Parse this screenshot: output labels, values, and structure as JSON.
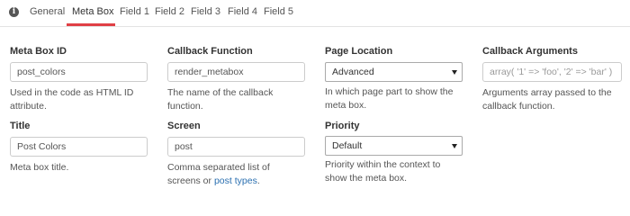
{
  "tabs": {
    "items": [
      {
        "label": "General"
      },
      {
        "label": "Meta Box"
      },
      {
        "label": "Field 1"
      },
      {
        "label": "Field 2"
      },
      {
        "label": "Field 3"
      },
      {
        "label": "Field 4"
      },
      {
        "label": "Field 5"
      }
    ],
    "active_index": 1,
    "info_icon": "info-icon"
  },
  "meta_box_id": {
    "label": "Meta Box ID",
    "value": "post_colors",
    "help": "Used in the code as HTML ID attribute."
  },
  "title": {
    "label": "Title",
    "value": "Post Colors",
    "help": "Meta box title."
  },
  "callback_function": {
    "label": "Callback Function",
    "value": "render_metabox",
    "help": "The name of the callback function."
  },
  "screen": {
    "label": "Screen",
    "value": "post",
    "help_text": "Comma separated list of screens or",
    "help_link": "post types",
    "help_end": "."
  },
  "page_location": {
    "label": "Page Location",
    "selected": "Advanced",
    "help": "In which page part to show the meta box."
  },
  "priority": {
    "label": "Priority",
    "selected": "Default",
    "help": "Priority within the context to show the meta box."
  },
  "callback_arguments": {
    "label": "Callback Arguments",
    "placeholder": "array( '1' => 'foo', '2' => 'bar' )",
    "help": "Arguments array passed to the callback function."
  },
  "colors": {
    "accent": "#e04045",
    "link": "#2a6fb0"
  }
}
